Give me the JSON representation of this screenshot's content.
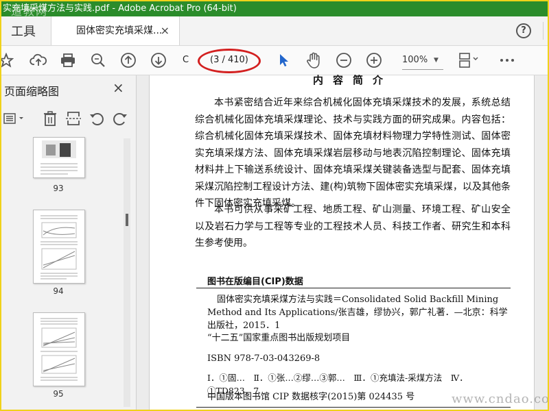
{
  "window": {
    "title": "实充填采煤方法与实践.pdf - Adobe Acrobat Pro (64-bit)",
    "watermark_top": "道教网"
  },
  "tabs": {
    "tools_label": "工具",
    "doc_tab_label": "固体密实充填采煤...",
    "close_symbol": "×",
    "help_symbol": "?"
  },
  "toolbar": {
    "page_input": "C",
    "page_count": "(3 / 410)",
    "zoom": "100%"
  },
  "sidebar": {
    "title": "页面缩略图",
    "close_symbol": "×",
    "thumbnails": [
      {
        "page": "93"
      },
      {
        "page": "94"
      },
      {
        "page": "95"
      }
    ]
  },
  "document": {
    "heading": "内容简介",
    "paragraph1": "本书紧密结合近年来综合机械化固体充填采煤技术的发展，系统总结综合机械化固体充填采煤理论、技术与实践方面的研究成果。内容包括：综合机械化固体充填采煤技术、固体充填材料物理力学特性测试、固体密实充填采煤方法、固体充填采煤岩层移动与地表沉陷控制理论、固体充填材料井上下输送系统设计、固体充填采煤关键装备选型与配套、固体充填采煤沉陷控制工程设计方法、建(构)筑物下固体密实充填采煤，以及其他条件下固体密实充填采煤。",
    "paragraph2": "本书可供从事采矿工程、地质工程、矿山测量、环境工程、矿山安全以及岩石力学与工程等专业的工程技术人员、科技工作者、研究生和本科生参考使用。",
    "cip_heading": "图书在版编目(CIP)数据",
    "cip_title": "固体密实充填采煤方法与实践＝Consolidated Solid Backfill Mining Method and Its Applications/张吉雄，缪协兴，郭广礼著．—北京：科学出版社，2015．1",
    "cip_project": "“十二五”国家重点图书出版规划项目",
    "isbn": "ISBN 978-7-03-043269-8",
    "cip_class": "Ⅰ．①固…　Ⅱ．①张…②缪…③郭…　Ⅲ．①充填法-采煤方法　Ⅳ．①TD823．7",
    "cip_record": "中国版本图书馆 CIP 数据核字(2015)第 024435 号"
  },
  "watermark_bottom": "www.cndao.com",
  "colors": {
    "titlebar": "#2b8c2b",
    "frame": "#f0d21a",
    "annotation": "#d32020",
    "select_tool": "#2266cc"
  }
}
